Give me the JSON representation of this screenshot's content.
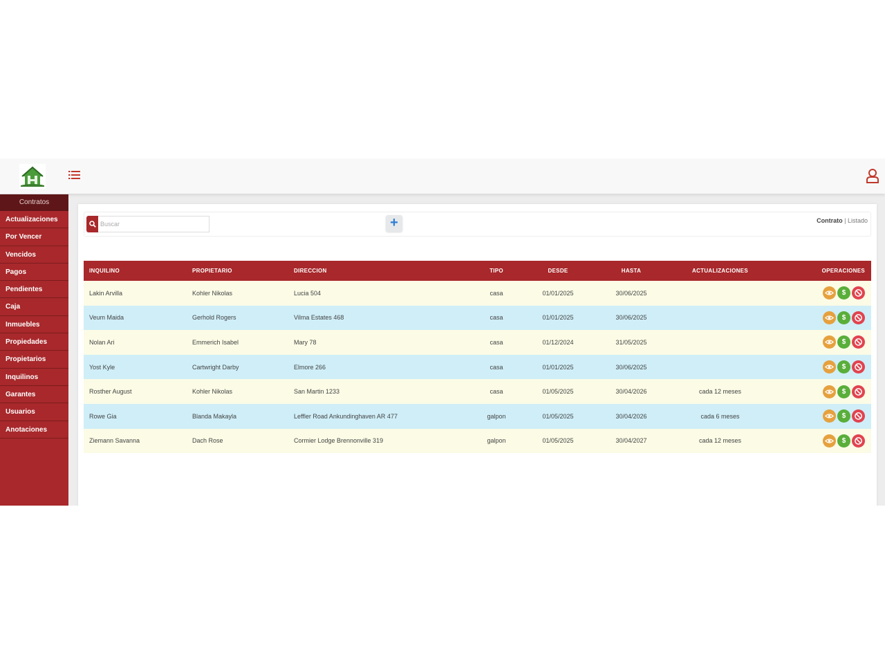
{
  "sidebar": {
    "header": "Contratos",
    "items": [
      {
        "label": "Actualizaciones"
      },
      {
        "label": "Por Vencer"
      },
      {
        "label": "Vencidos"
      },
      {
        "label": "Pagos"
      },
      {
        "label": "Pendientes"
      },
      {
        "label": "Caja"
      },
      {
        "label": "Inmuebles"
      },
      {
        "label": "Propiedades"
      },
      {
        "label": "Propietarios"
      },
      {
        "label": "Inquilinos"
      },
      {
        "label": "Garantes"
      },
      {
        "label": "Usuarios"
      },
      {
        "label": "Anotaciones"
      }
    ]
  },
  "toolbar": {
    "search_placeholder": "Buscar",
    "add_label": "+",
    "breadcrumb_active": "Contrato",
    "breadcrumb_sep": "|",
    "breadcrumb_link": "Listado"
  },
  "table": {
    "headers": [
      "INQUILINO",
      "PROPIETARIO",
      "DIRECCION",
      "TIPO",
      "DESDE",
      "HASTA",
      "ACTUALIZACIONES",
      "OPERACIONES"
    ],
    "rows": [
      {
        "inquilino": "Lakin Arvilla",
        "propietario": "Kohler Nikolas",
        "direccion": "Lucia 504",
        "tipo": "casa",
        "desde": "01/01/2025",
        "hasta": "30/06/2025",
        "actualizaciones": ""
      },
      {
        "inquilino": "Veum Maida",
        "propietario": "Gerhold Rogers",
        "direccion": "Vilma Estates 468",
        "tipo": "casa",
        "desde": "01/01/2025",
        "hasta": "30/06/2025",
        "actualizaciones": ""
      },
      {
        "inquilino": "Nolan Ari",
        "propietario": "Emmerich Isabel",
        "direccion": "Mary 78",
        "tipo": "casa",
        "desde": "01/12/2024",
        "hasta": "31/05/2025",
        "actualizaciones": ""
      },
      {
        "inquilino": "Yost Kyle",
        "propietario": "Cartwright Darby",
        "direccion": "Elmore 266",
        "tipo": "casa",
        "desde": "01/01/2025",
        "hasta": "30/06/2025",
        "actualizaciones": ""
      },
      {
        "inquilino": "Rosther August",
        "propietario": "Kohler Nikolas",
        "direccion": "San Martin 1233",
        "tipo": "casa",
        "desde": "01/05/2025",
        "hasta": "30/04/2026",
        "actualizaciones": "cada 12 meses"
      },
      {
        "inquilino": "Rowe Gia",
        "propietario": "Blanda Makayla",
        "direccion": "Leffler Road Ankundinghaven AR 477",
        "tipo": "galpon",
        "desde": "01/05/2025",
        "hasta": "30/04/2026",
        "actualizaciones": "cada 6 meses"
      },
      {
        "inquilino": "Ziemann Savanna",
        "propietario": "Dach Rose",
        "direccion": "Cormier Lodge Brennonville 319",
        "tipo": "galpon",
        "desde": "01/05/2025",
        "hasta": "30/04/2027",
        "actualizaciones": "cada 12 meses"
      }
    ]
  },
  "operations": {
    "pay_symbol": "$"
  },
  "icons": {
    "logo": "house-logo-icon",
    "menu": "list-menu-icon",
    "user": "user-icon",
    "search": "search-icon",
    "view": "eye-icon",
    "pay": "dollar-icon",
    "cancel": "ban-icon"
  },
  "colors": {
    "primary": "#a8282b",
    "sidebar_header": "#5e1618",
    "row_odd": "#fbfbe6",
    "row_even": "#cfeef8",
    "view": "#e6a13e",
    "pay": "#5aae3a",
    "cancel": "#e1434f",
    "add": "#2f7dd6"
  }
}
